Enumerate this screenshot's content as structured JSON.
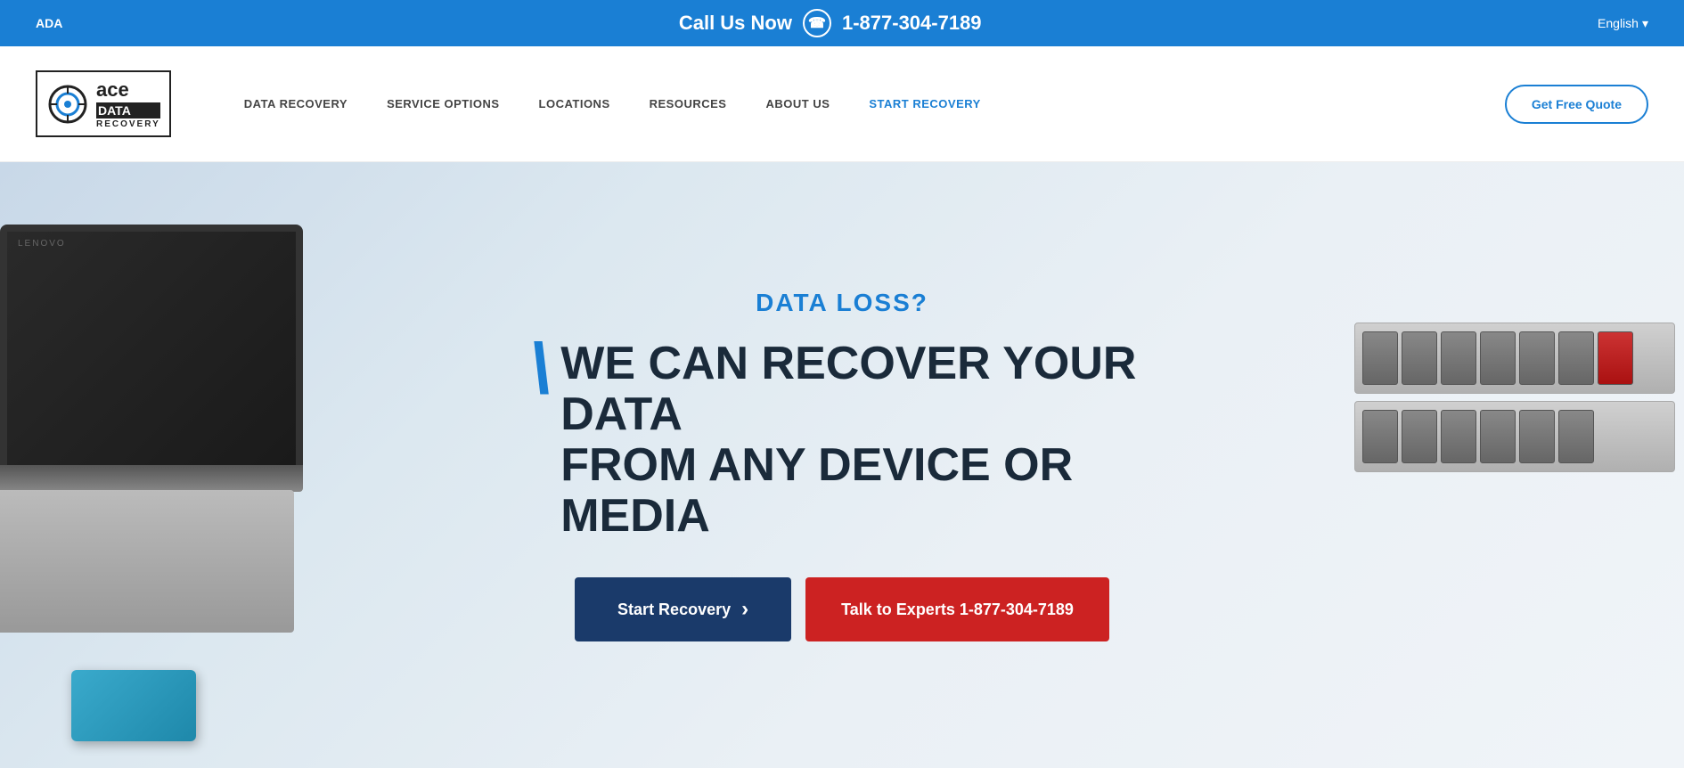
{
  "topbar": {
    "left_label": "ADA",
    "call_label": "Call Us Now",
    "phone_number": "1-877-304-7189",
    "language": "English",
    "language_icon": "▾"
  },
  "navbar": {
    "logo_ace": "ace",
    "logo_data": "DATA",
    "logo_recovery": "RECOVERY",
    "nav_items": [
      {
        "label": "DATA RECOVERY",
        "active": false
      },
      {
        "label": "SERVICE OPTIONS",
        "active": false
      },
      {
        "label": "LOCATIONS",
        "active": false
      },
      {
        "label": "RESOURCES",
        "active": false
      },
      {
        "label": "ABOUT US",
        "active": false
      },
      {
        "label": "START RECOVERY",
        "active": true
      }
    ],
    "cta_button": "Get Free Quote"
  },
  "hero": {
    "data_loss_label": "DATA LOSS?",
    "headline_line1": "WE CAN RECOVER YOUR DATA",
    "headline_line2": "FROM ANY DEVICE OR MEDIA",
    "btn_start": "Start Recovery",
    "btn_start_icon": "›",
    "btn_talk": "Talk to Experts 1-877-304-7189"
  }
}
